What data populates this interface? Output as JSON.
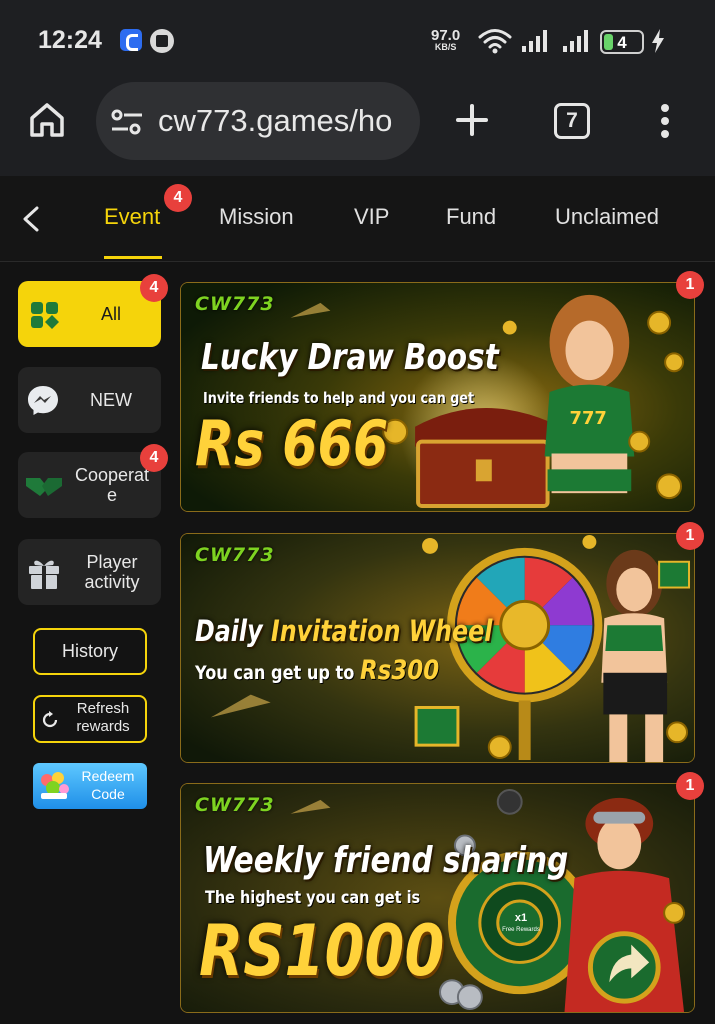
{
  "status_bar": {
    "time": "12:24",
    "net_speed_value": "97.0",
    "net_speed_unit": "KB/S",
    "battery_level": "4"
  },
  "browser": {
    "url": "cw773.games/ho",
    "tab_count": "7"
  },
  "tabs": [
    {
      "label": "Event",
      "badge": "4",
      "active": true
    },
    {
      "label": "Mission"
    },
    {
      "label": "VIP"
    },
    {
      "label": "Fund"
    },
    {
      "label": "Unclaimed"
    }
  ],
  "sidebar": {
    "categories": [
      {
        "label": "All",
        "badge": "4",
        "active": true,
        "icon": "clover-icon"
      },
      {
        "label": "NEW",
        "icon": "messenger-icon"
      },
      {
        "label": "Cooperat\ne",
        "badge": "4",
        "icon": "handshake-icon"
      },
      {
        "label": "Player\nactivity",
        "icon": "gift-icon"
      }
    ],
    "buttons": {
      "history": "History",
      "refresh": "Refresh\nrewards",
      "redeem": "Redeem\nCode"
    }
  },
  "banners": [
    {
      "logo": "CW773",
      "title": "Lucky Draw Boost",
      "subtitle": "Invite friends to help and you can get",
      "amount": "Rs 666",
      "badge": "1"
    },
    {
      "logo": "CW773",
      "title_a": "Daily",
      "title_b": "Invitation Wheel",
      "subtitle_prefix": "You can get up to",
      "amount": "Rs300",
      "badge": "1"
    },
    {
      "logo": "CW773",
      "title": "Weekly friend sharing",
      "subtitle": "The highest you can get is",
      "amount": "RS1000",
      "badge": "1",
      "wheel_center": "x1",
      "wheel_center_sub": "Free Rewards"
    }
  ],
  "colors": {
    "accent": "#f5d40b",
    "badge": "#e8403c",
    "background": "#131313"
  }
}
